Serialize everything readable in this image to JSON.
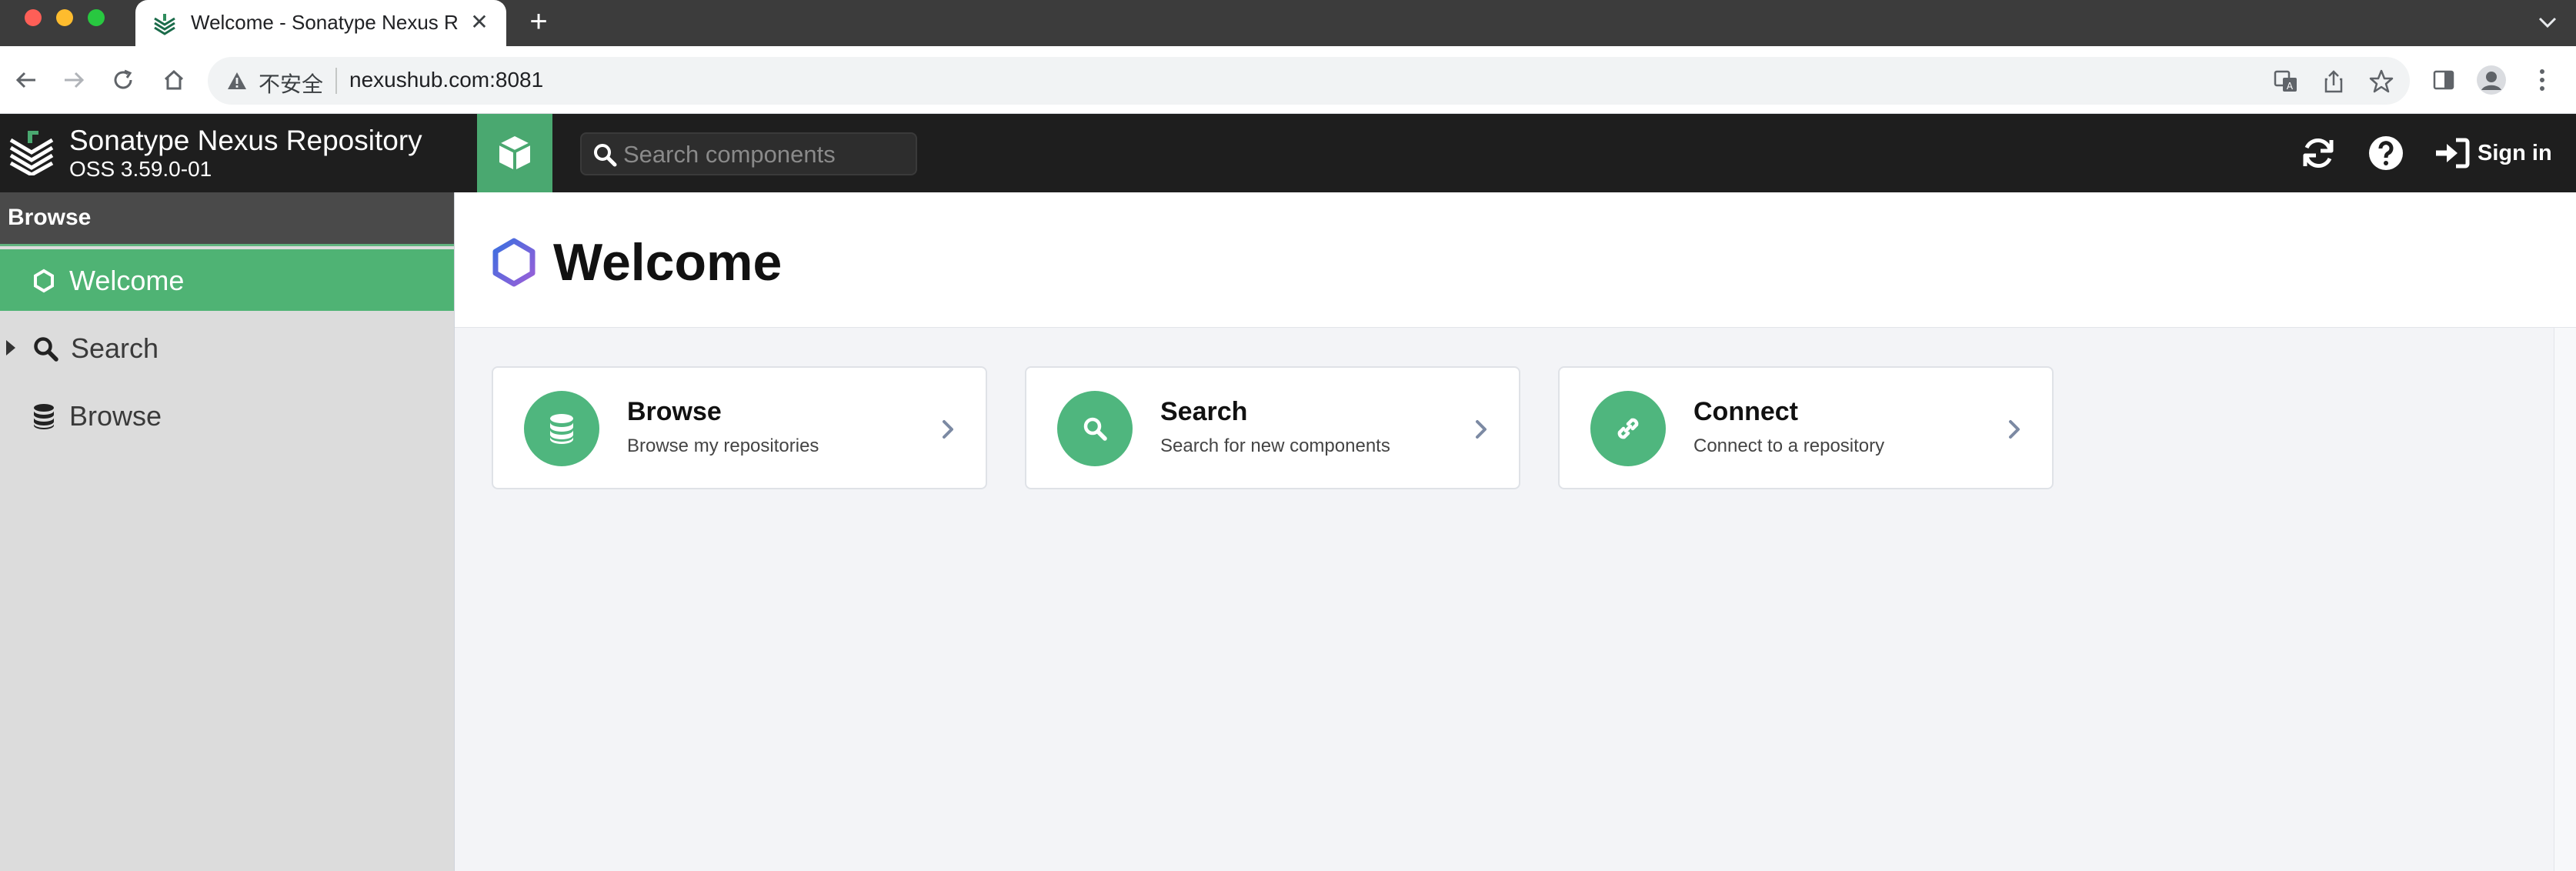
{
  "browser": {
    "tab": {
      "title": "Welcome - Sonatype Nexus Re",
      "close_glyph": "✕",
      "favicon": "nexus-favicon-icon"
    },
    "new_tab_glyph": "+",
    "address": {
      "security_label": "不安全",
      "url": "nexushub.com:8081"
    }
  },
  "header": {
    "product_name": "Sonatype Nexus Repository",
    "version": "OSS 3.59.0-01",
    "search": {
      "placeholder": "Search components"
    },
    "sign_in_label": "Sign in",
    "colors": {
      "bar": "#1e1e1e",
      "accent": "#4aa870"
    }
  },
  "sidebar": {
    "title": "Browse",
    "items": [
      {
        "label": "Welcome",
        "icon": "hexagon-icon",
        "active": true
      },
      {
        "label": "Search",
        "icon": "search-icon",
        "expandable": true
      },
      {
        "label": "Browse",
        "icon": "database-icon"
      }
    ]
  },
  "main": {
    "title": "Welcome",
    "cards": [
      {
        "title": "Browse",
        "subtitle": "Browse my repositories",
        "icon": "database-icon"
      },
      {
        "title": "Search",
        "subtitle": "Search for new components",
        "icon": "search-icon"
      },
      {
        "title": "Connect",
        "subtitle": "Connect to a repository",
        "icon": "link-icon"
      }
    ],
    "colors": {
      "card_icon_bg": "#4fb67e",
      "active_item": "#4fb374"
    }
  }
}
